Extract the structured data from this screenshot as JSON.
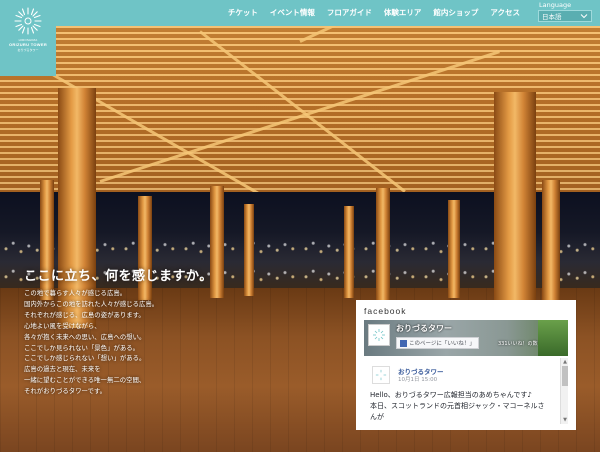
{
  "brand": {
    "logo_small": "HIROSHIMA",
    "logo_main": "ORIZURU TOWER",
    "logo_sub": "おりづるタワー"
  },
  "nav": {
    "items": [
      {
        "label": "チケット"
      },
      {
        "label": "イベント情報"
      },
      {
        "label": "フロアガイド"
      },
      {
        "label": "体験エリア"
      },
      {
        "label": "館内ショップ"
      },
      {
        "label": "アクセス"
      }
    ]
  },
  "language": {
    "label": "Language",
    "selected": "日本語"
  },
  "hero": {
    "headline": "ここに立ち、何を感じますか。",
    "copy_lines": [
      "この地で暮らす人々が感じる広島。",
      "国内外からこの地を訪れた人々が感じる広島。",
      "それぞれが感じる、広島の姿があります。",
      "心地よい風を受けながら、",
      "各々が抱く未来への思い、広島への想い。",
      "ここでしか見られない「景色」がある。",
      "ここでしか感じられない「想い」がある。",
      "広島の過去と現在、未来を",
      "一緒に望むことができる唯一無二の空間、",
      "それがおりづるタワーです。"
    ]
  },
  "facebook": {
    "title": "facebook",
    "page_name": "おりづるタワー",
    "like_button": "このページに「いいね！」",
    "like_count": "331いいね！の数",
    "post_name": "おりづるタワー",
    "post_date": "10月1日 15:00",
    "post_lines": [
      "Hello、おりづるタワー広報担当のあめちゃんです♪",
      "本日、スコットランドの元首相ジャック・マコーネルさ",
      "んが"
    ]
  },
  "colors": {
    "header_bg": "#6fc4c6",
    "text_light": "#ffffff",
    "fb_link": "#365899"
  }
}
